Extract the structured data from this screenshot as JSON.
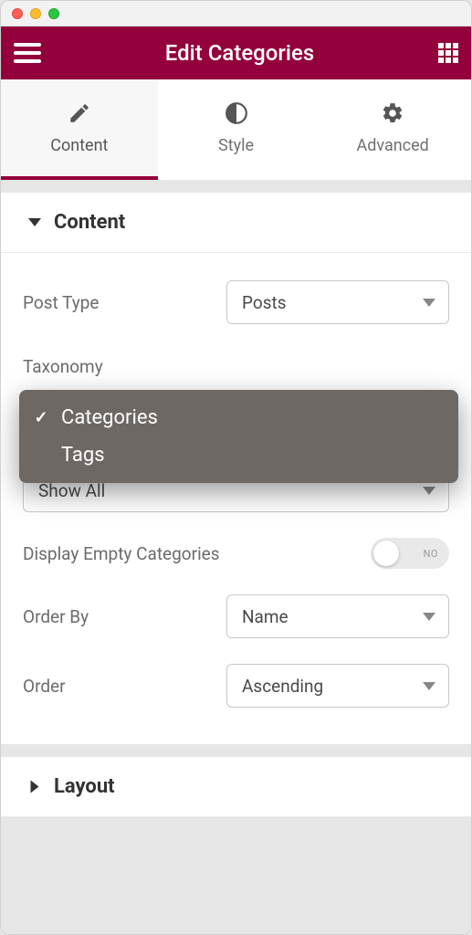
{
  "header": {
    "title": "Edit Categories"
  },
  "tabs": {
    "content": "Content",
    "style": "Style",
    "advanced": "Advanced"
  },
  "sections": {
    "content": {
      "title": "Content",
      "post_type": {
        "label": "Post Type",
        "value": "Posts"
      },
      "taxonomy": {
        "label": "Taxonomy"
      },
      "filter_rule": {
        "value": "Show All"
      },
      "display_empty": {
        "label": "Display Empty Categories",
        "toggle_text": "NO"
      },
      "order_by": {
        "label": "Order By",
        "value": "Name"
      },
      "order": {
        "label": "Order",
        "value": "Ascending"
      }
    },
    "layout": {
      "title": "Layout"
    }
  },
  "dropdown": {
    "items": [
      {
        "label": "Categories",
        "selected": true
      },
      {
        "label": "Tags",
        "selected": false
      }
    ]
  }
}
